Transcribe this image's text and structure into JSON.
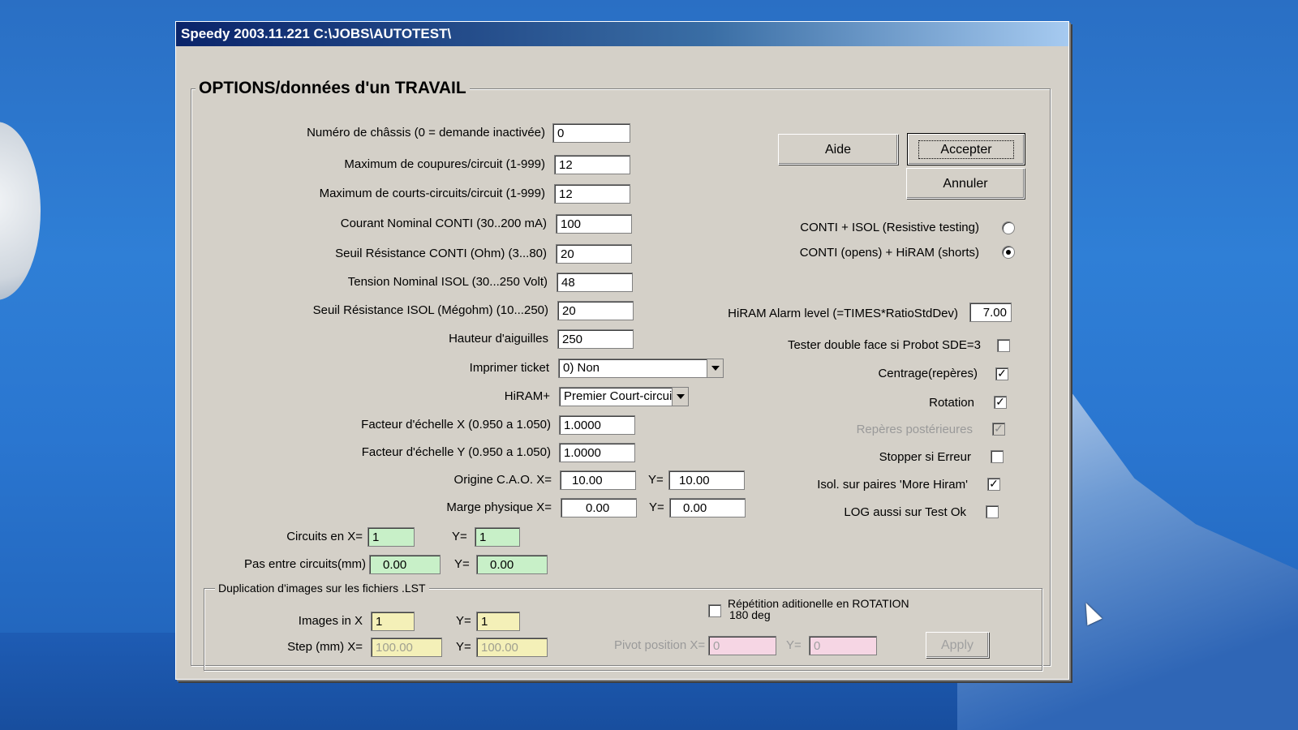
{
  "window": {
    "title": "Speedy 2003.11.221  C:\\JOBS\\AUTOTEST\\"
  },
  "main_group": {
    "title": "OPTIONS/données d'un TRAVAIL"
  },
  "fields": {
    "chassis": {
      "label": "Numéro de châssis (0 = demande inactivée)",
      "value": "0"
    },
    "max_coupures": {
      "label": "Maximum de coupures/circuit (1-999)",
      "value": "12"
    },
    "max_courts": {
      "label": "Maximum de courts-circuits/circuit (1-999)",
      "value": "12"
    },
    "courant_conti": {
      "label": "Courant Nominal CONTI (30..200 mA)",
      "value": "100"
    },
    "seuil_conti": {
      "label": "Seuil Résistance CONTI (Ohm) (3...80)",
      "value": "20"
    },
    "tension_isol": {
      "label": "Tension Nominal ISOL  (30...250 Volt)",
      "value": "48"
    },
    "seuil_isol": {
      "label": "Seuil Résistance ISOL (Mégohm) (10...250)",
      "value": "20"
    },
    "hauteur": {
      "label": "Hauteur d'aiguilles",
      "value": "250"
    },
    "ticket": {
      "label": "Imprimer ticket",
      "value": "0) Non"
    },
    "hiram_plus": {
      "label": "HiRAM+",
      "value": "Premier Court-circui"
    },
    "facteur_x": {
      "label": "Facteur d'échelle X (0.950 a 1.050)",
      "value": "1.0000"
    },
    "facteur_y": {
      "label": "Facteur d'échelle Y (0.950 a 1.050)",
      "value": "1.0000"
    },
    "origine": {
      "label": "Origine C.A.O.  X=",
      "x": "10.00",
      "ylabel": "Y=",
      "y": "10.00"
    },
    "marge": {
      "label": "Marge physique X=",
      "x": "0.00",
      "ylabel": "Y=",
      "y": "0.00"
    },
    "circuits": {
      "label": "Circuits en X=",
      "x": "1",
      "ylabel": "Y=",
      "y": "1"
    },
    "pas": {
      "label": "Pas entre circuits(mm)",
      "x": "0.00",
      "ylabel": "Y=",
      "y": "0.00"
    }
  },
  "buttons": {
    "aide": "Aide",
    "accepter": "Accepter",
    "annuler": "Annuler",
    "apply": "Apply"
  },
  "modes": {
    "conti_isol": {
      "label": "CONTI + ISOL (Resistive testing)",
      "selected": false
    },
    "conti_hiram": {
      "label": "CONTI (opens) + HiRAM (shorts)",
      "selected": true
    }
  },
  "hiram_alarm": {
    "label": "HiRAM Alarm level (=TIMES*RatioStdDev)",
    "value": "7.00"
  },
  "checks": {
    "double_face": {
      "label": "Tester double face si Probot SDE=3",
      "checked": false
    },
    "centrage": {
      "label": "Centrage(repères)",
      "checked": true
    },
    "rotation": {
      "label": "Rotation",
      "checked": true
    },
    "reperes_post": {
      "label": "Repères postérieures",
      "checked": true
    },
    "stopper": {
      "label": "Stopper si Erreur",
      "checked": false
    },
    "isol_paires": {
      "label": "Isol. sur paires 'More Hiram'",
      "checked": true
    },
    "log_ok": {
      "label": "LOG aussi sur Test Ok",
      "checked": false
    }
  },
  "duplication": {
    "title": "Duplication d'images sur les fichiers .LST",
    "images_label": "Images in X",
    "images_x": "1",
    "images_ylabel": "Y=",
    "images_y": "1",
    "step_label": "Step (mm) X=",
    "step_x": "100.00",
    "step_ylabel": "Y=",
    "step_y": "100.00",
    "repetition_label_1": "Répétition aditionelle en ROTATION",
    "repetition_label_2": "180 deg",
    "pivot_label": "Pivot position X=",
    "pivot_x": "0",
    "pivot_ylabel": "Y=",
    "pivot_y": "0"
  },
  "colors": {
    "titlebar": "#0a246a",
    "dialog": "#d4d0c8",
    "green_field": "#c8f0c8",
    "yellow_field": "#f4f0b8",
    "pink_field": "#f6d6e4"
  }
}
